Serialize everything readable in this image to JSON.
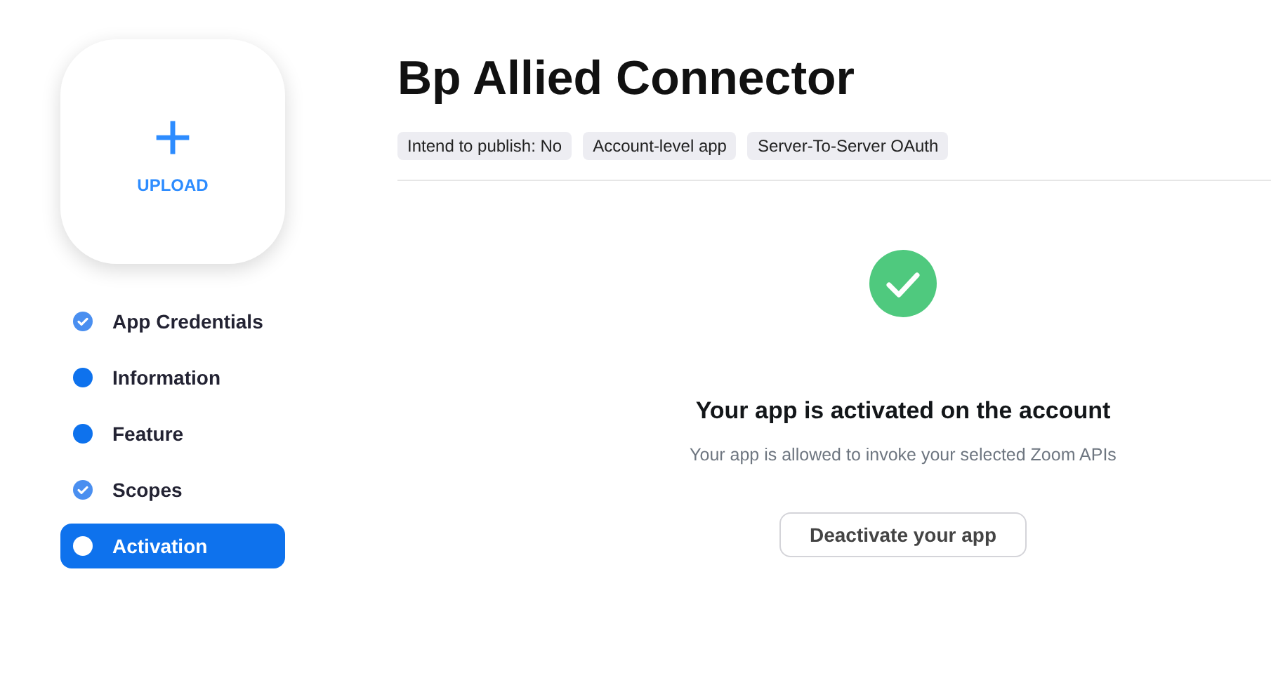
{
  "upload": {
    "icon": "+",
    "label": "UPLOAD"
  },
  "steps": [
    {
      "label": "App Credentials",
      "kind": "done",
      "selected": false
    },
    {
      "label": "Information",
      "kind": "dot",
      "selected": false
    },
    {
      "label": "Feature",
      "kind": "dot",
      "selected": false
    },
    {
      "label": "Scopes",
      "kind": "done",
      "selected": false
    },
    {
      "label": "Activation",
      "kind": "dot",
      "selected": true
    }
  ],
  "title": "Bp Allied Connector",
  "tags": [
    "Intend to publish: No",
    "Account-level app",
    "Server-To-Server OAuth"
  ],
  "status": {
    "heading": "Your app is activated on the account",
    "message": "Your app is allowed to invoke your selected Zoom APIs",
    "button": "Deactivate your app"
  }
}
